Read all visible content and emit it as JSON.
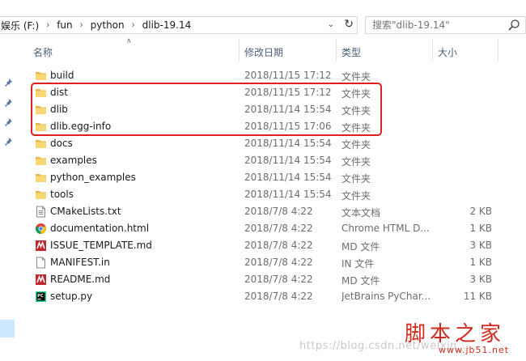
{
  "address_bar": {
    "breadcrumbs": [
      "娱乐 (F:)",
      "fun",
      "python",
      "dlib-19.14"
    ]
  },
  "search": {
    "placeholder": "搜索\"dlib-19.14\""
  },
  "columns": {
    "name": "名称",
    "date": "修改日期",
    "type": "类型",
    "size": "大小"
  },
  "files": [
    {
      "name": "build",
      "date": "2018/11/15 17:12",
      "type": "文件夹",
      "size": "",
      "icon": "folder-icon"
    },
    {
      "name": "dist",
      "date": "2018/11/15 17:12",
      "type": "文件夹",
      "size": "",
      "icon": "folder-icon"
    },
    {
      "name": "dlib",
      "date": "2018/11/14 15:54",
      "type": "文件夹",
      "size": "",
      "icon": "folder-icon"
    },
    {
      "name": "dlib.egg-info",
      "date": "2018/11/15 17:06",
      "type": "文件夹",
      "size": "",
      "icon": "folder-icon"
    },
    {
      "name": "docs",
      "date": "2018/11/14 15:54",
      "type": "文件夹",
      "size": "",
      "icon": "folder-icon"
    },
    {
      "name": "examples",
      "date": "2018/11/14 15:54",
      "type": "文件夹",
      "size": "",
      "icon": "folder-icon"
    },
    {
      "name": "python_examples",
      "date": "2018/11/14 15:54",
      "type": "文件夹",
      "size": "",
      "icon": "folder-icon"
    },
    {
      "name": "tools",
      "date": "2018/11/14 15:54",
      "type": "文件夹",
      "size": "",
      "icon": "folder-icon"
    },
    {
      "name": "CMakeLists.txt",
      "date": "2018/7/8 4:22",
      "type": "文本文档",
      "size": "2 KB",
      "icon": "text-file-icon"
    },
    {
      "name": "documentation.html",
      "date": "2018/7/8 4:22",
      "type": "Chrome HTML D...",
      "size": "1 KB",
      "icon": "chrome-icon"
    },
    {
      "name": "ISSUE_TEMPLATE.md",
      "date": "2018/7/8 4:22",
      "type": "MD 文件",
      "size": "3 KB",
      "icon": "markdown-file-icon"
    },
    {
      "name": "MANIFEST.in",
      "date": "2018/7/8 4:22",
      "type": "IN 文件",
      "size": "1 KB",
      "icon": "blank-file-icon"
    },
    {
      "name": "README.md",
      "date": "2018/7/8 4:22",
      "type": "MD 文件",
      "size": "3 KB",
      "icon": "markdown-file-icon"
    },
    {
      "name": "setup.py",
      "date": "2018/7/8 4:22",
      "type": "JetBrains PyChar...",
      "size": "11 KB",
      "icon": "pycharm-icon"
    }
  ],
  "watermark": {
    "blog_url": "https://blog.csdn.net/weixin_...",
    "logo_text": "脚本之家",
    "logo_url": "www.jb51.net"
  },
  "colors": {
    "highlight": "#e02020",
    "folder": "#f5c957",
    "header_text": "#4c607a",
    "secondary_text": "#6d6d6d"
  }
}
